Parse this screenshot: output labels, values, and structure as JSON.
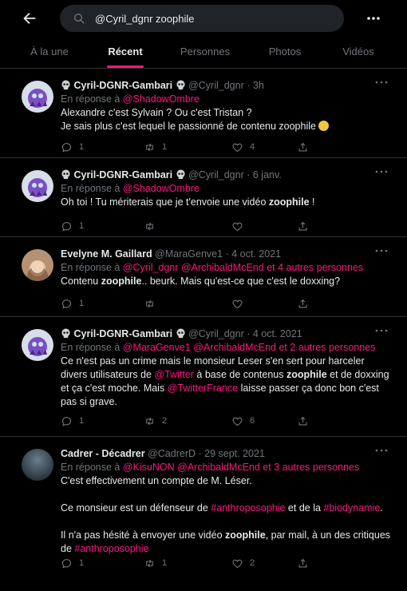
{
  "search": {
    "value": "@Cyril_dgnr zoophile"
  },
  "tabs": [
    {
      "label": "À la une"
    },
    {
      "label": "Récent"
    },
    {
      "label": "Personnes"
    },
    {
      "label": "Photos"
    },
    {
      "label": "Vidéos"
    }
  ],
  "active_tab": "Récent",
  "accent_color": "#f91880",
  "tweets": [
    {
      "name": "Cyril-DGNR-Gambari",
      "handle": "@Cyril_dgnr",
      "time": "· 3h",
      "reply_prefix": "En réponse à",
      "reply_to": [
        "@ShadowOmbre"
      ],
      "reply_more": "",
      "body_line1": "Alexandre c'est Sylvain ? Ou c'est Tristan ?",
      "body_line2": "Je sais plus c'est lequel le passionné de contenu zoophile",
      "replies": "1",
      "retweets": "1",
      "likes": "4"
    },
    {
      "name": "Cyril-DGNR-Gambari",
      "handle": "@Cyril_dgnr",
      "time": "· 6 janv.",
      "reply_prefix": "En réponse à",
      "reply_to": [
        "@ShadowOmbre"
      ],
      "body_pre": "Oh toi ! Tu mériterais que je t'envoie une vidéo ",
      "body_bold": "zoophile",
      "body_post": " !",
      "replies": "1",
      "retweets": "",
      "likes": ""
    },
    {
      "name": "Evelyne M. Gaillard",
      "handle": "@MaraGenve1",
      "time": "· 4 oct. 2021",
      "reply_prefix": "En réponse à",
      "reply_to": [
        "@Cyril_dgnr",
        "@ArchibaldMcEnd"
      ],
      "reply_more": "et 4 autres personnes",
      "body_pre": "Contenu ",
      "body_bold": "zoophile",
      "body_post": ".. beurk. Mais qu'est-ce que c'est le doxxing?",
      "replies": "1",
      "retweets": "",
      "likes": ""
    },
    {
      "name": "Cyril-DGNR-Gambari",
      "handle": "@Cyril_dgnr",
      "time": "· 4 oct. 2021",
      "reply_prefix": "En réponse à",
      "reply_to": [
        "@MaraGenve1",
        "@ArchibaldMcEnd"
      ],
      "reply_more": "et 2 autres personnes",
      "body_a": "Ce n'est pas un crime mais le monsieur Leser s'en sert pour harceler divers utilisateurs de ",
      "body_link1": "@Twitter",
      "body_b": " à base de contenus ",
      "body_bold": "zoophile",
      "body_c": " et de doxxing et ça c'est moche. Mais ",
      "body_link2": "@TwitterFrance",
      "body_d": " laisse passer ça donc bon c'est pas si grave.",
      "replies": "1",
      "retweets": "2",
      "likes": "6"
    },
    {
      "name": "Cadrer - Décadrer",
      "handle": "@CadrerD",
      "time": "· 29 sept. 2021",
      "reply_prefix": "En réponse à",
      "reply_to": [
        "@KisuNON",
        "@ArchibaldMcEnd"
      ],
      "reply_more": "et 3 autres personnes",
      "p1": "C'est effectivement un compte de M. Léser.",
      "p2_a": "Ce monsieur est un défenseur de ",
      "p2_link1": "#anthroposophie",
      "p2_b": " et de la ",
      "p2_link2": "#biodynamie",
      "p2_c": ".",
      "p3_a": "Il n'a pas hésité à envoyer une vidéo ",
      "p3_bold": "zoophile",
      "p3_b": ", par mail, à un des critiques de ",
      "p3_link": "#anthroposophie",
      "replies": "1",
      "retweets": "1",
      "likes": "2"
    }
  ]
}
